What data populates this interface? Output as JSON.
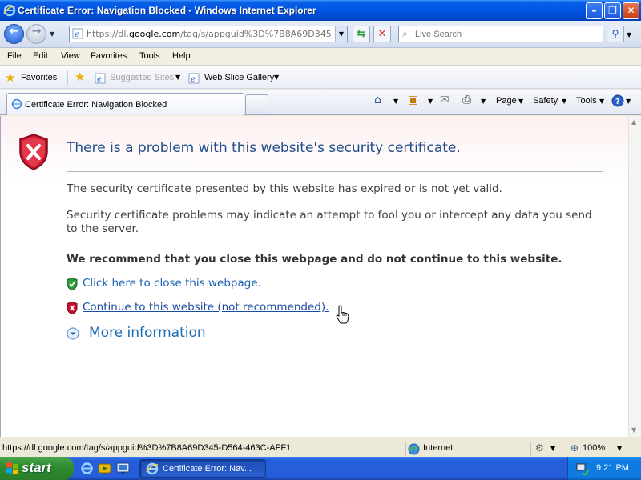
{
  "window": {
    "title": "Certificate Error: Navigation Blocked - Windows Internet Explorer",
    "minimize_glyph": "–",
    "restore_glyph": "❐",
    "close_glyph": "✕"
  },
  "address_bar": {
    "url_prefix": "https://dl.",
    "url_domain": "google.com",
    "url_suffix": "/tag/s/appguid%3D%7B8A69D345-D564-",
    "search_placeholder": "Live Search"
  },
  "menu": {
    "items": [
      "File",
      "Edit",
      "View",
      "Favorites",
      "Tools",
      "Help"
    ]
  },
  "favorites_bar": {
    "favorites_label": "Favorites",
    "suggested_sites": "Suggested Sites",
    "web_slice_gallery": "Web Slice Gallery"
  },
  "tabs": {
    "active_label": "Certificate Error: Navigation Blocked"
  },
  "command_bar": {
    "page": "Page",
    "safety": "Safety",
    "tools": "Tools"
  },
  "content": {
    "title": "There is a problem with this website's security certificate.",
    "p1": "The security certificate presented by this website has expired or is not yet valid.",
    "p2": "Security certificate problems may indicate an attempt to fool you or intercept any data you send to the server.",
    "p3": "We recommend that you close this webpage and do not continue to this website.",
    "close_link": "Click here to close this webpage.",
    "continue_link": "Continue to this website (not recommended).",
    "more_info": "More information"
  },
  "status_bar": {
    "url": "https://dl.google.com/tag/s/appguid%3D%7B8A69D345-D564-463C-AFF1",
    "zone": "Internet",
    "zoom": "100%"
  },
  "taskbar": {
    "start_label": "start",
    "task_label": "Certificate Error: Nav...",
    "clock": "9:21 PM"
  },
  "colors": {
    "title_blue": "#1f4d8a",
    "link_blue": "#1d62b8",
    "taskbar_blue": "#245edb",
    "start_green": "#2f8b2f",
    "shield_red": "#c8102e"
  },
  "icons": {
    "back": "back-arrow-icon",
    "forward": "forward-arrow-icon",
    "refresh": "refresh-icon",
    "stop": "stop-icon",
    "search": "magnifier-icon",
    "home": "home-icon",
    "rss": "feeds-icon",
    "mail": "mail-icon",
    "print": "printer-icon",
    "help": "help-icon",
    "shield_error": "red-shield-x-icon",
    "shield_ok": "green-shield-check-icon",
    "more_info": "chevron-down-circle-icon",
    "globe": "globe-icon"
  }
}
